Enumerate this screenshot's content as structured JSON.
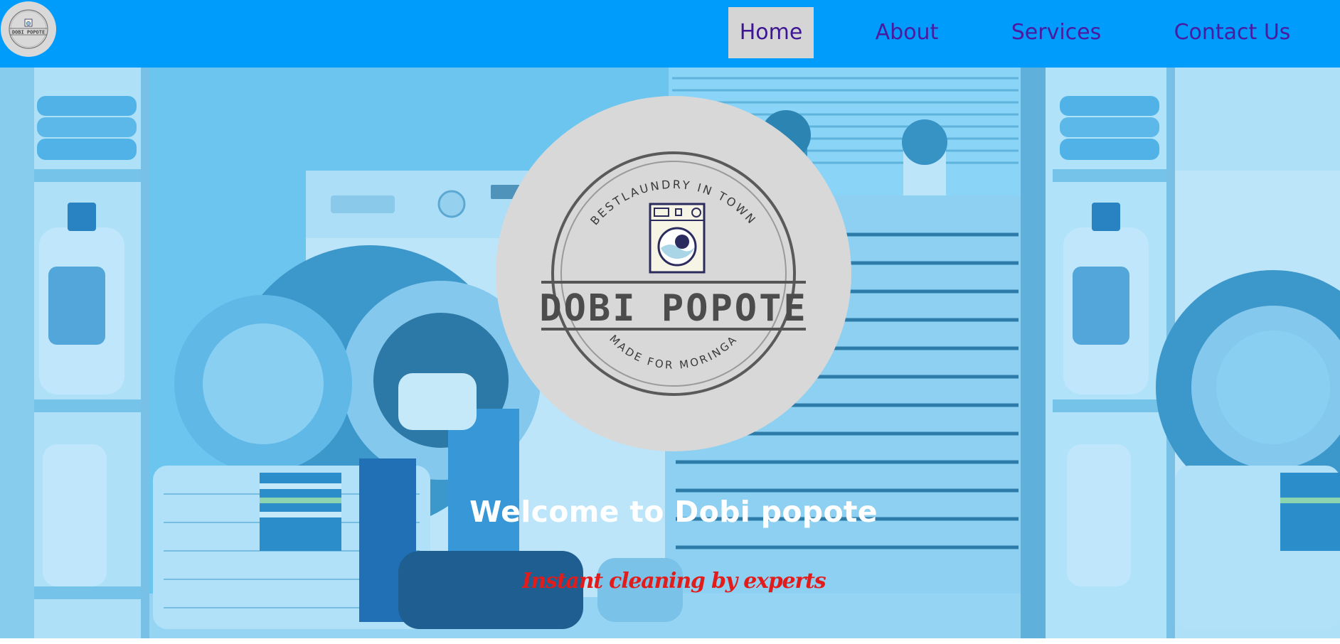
{
  "nav": {
    "logo": {
      "brand": "DOBI POPOTE",
      "arc_top": "BESTLAUNDRY IN TOWN",
      "arc_bottom": "MADE FOR MORINGA"
    },
    "items": [
      {
        "label": "Home",
        "active": true
      },
      {
        "label": "About",
        "active": false
      },
      {
        "label": "Services",
        "active": false
      },
      {
        "label": "Contact Us",
        "active": false
      }
    ],
    "colors": {
      "bar": "#009cfb",
      "link": "#4a1aa0",
      "active_bg": "#d5d5d5"
    }
  },
  "hero": {
    "logo": {
      "arc_top": "BESTLAUNDRY  IN TOWN",
      "brand": "DOBI POPOTE",
      "arc_bottom": "MADE FOR MORINGA",
      "icon": "washing-machine-icon"
    },
    "title": "Welcome to Dobi popote",
    "tagline": "Instant cleaning by experts",
    "colors": {
      "title": "#ffffff",
      "tagline": "#e21b1b",
      "overlay": "#2aa8e8"
    }
  }
}
